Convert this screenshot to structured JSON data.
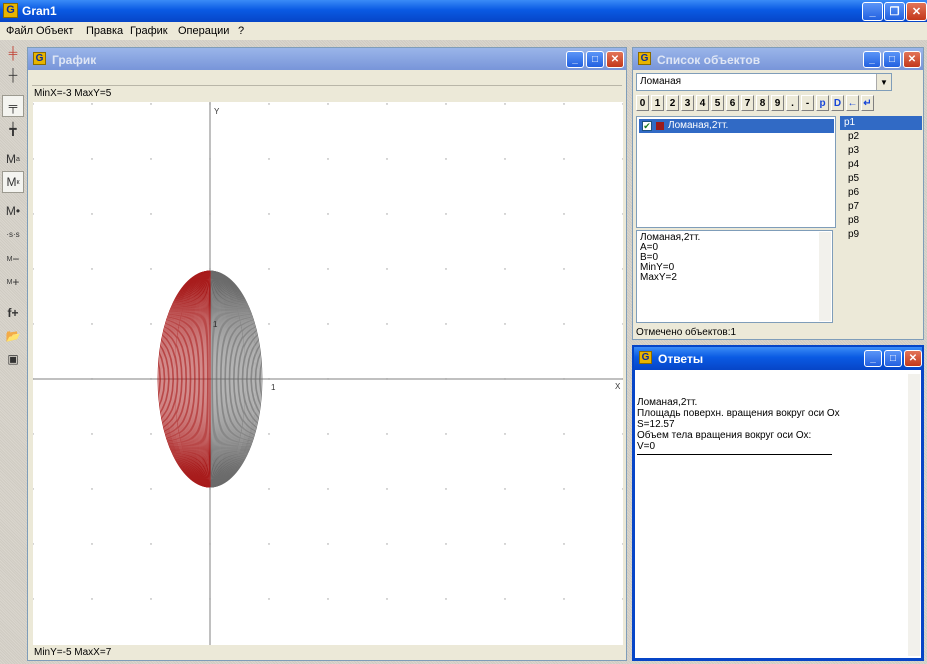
{
  "app": {
    "title": "Gran1"
  },
  "menu": [
    "Файл",
    "Объект",
    "Правка",
    "График",
    "Операции",
    "?"
  ],
  "graph": {
    "title": "График",
    "info_top": "MinX=-3  MaxY=5",
    "info_bottom": "MinY=-5  MaxX=7",
    "axis_x_label": "X",
    "axis_y_label": "Y",
    "tick_x_label": "1",
    "tick_y_label": "1",
    "colors": {
      "red": "#a81c1c",
      "grey": "#6b6b6b",
      "axis": "#808080"
    }
  },
  "object_list": {
    "title": "Список объектов",
    "combo_value": "Ломаная",
    "keys": [
      "0",
      "1",
      "2",
      "3",
      "4",
      "5",
      "6",
      "7",
      "8",
      "9",
      ".",
      "-",
      "p",
      "D",
      "←",
      "↵"
    ],
    "item": "Ломаная,2тт.",
    "points": [
      "p1",
      "p2",
      "p3",
      "p4",
      "p5",
      "p6",
      "p7",
      "p8",
      "p9"
    ],
    "info": [
      "Ломаная,2тт.",
      "A=0",
      "B=0",
      "MinY=0",
      "MaxY=2"
    ],
    "status": "Отмечено объектов:1"
  },
  "answers": {
    "title": "Ответы",
    "lines": [
      "Ломаная,2тт.",
      "Площадь поверхн. вращения вокруг оси Ох",
      "S=12.57",
      "Объем тела вращения вокруг оси Ох:",
      "V=0"
    ]
  },
  "window_buttons": {
    "minimize": "_",
    "maximize": "□",
    "close": "✕",
    "restore": "❐"
  }
}
